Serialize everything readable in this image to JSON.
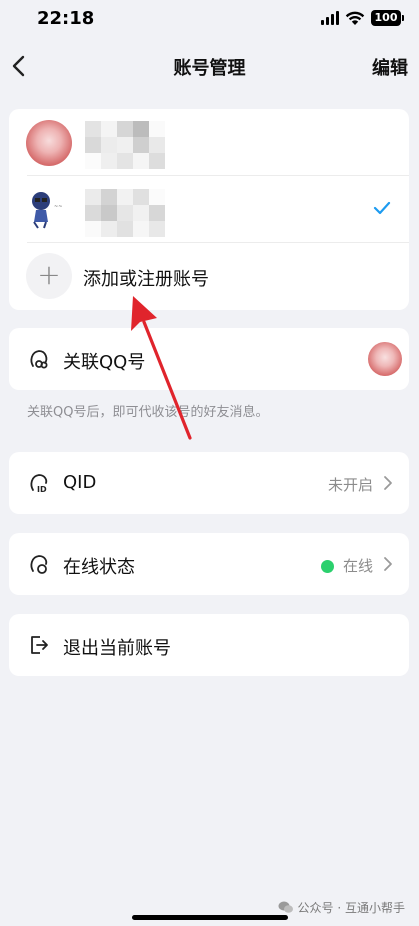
{
  "status_bar": {
    "time": "22:18",
    "battery": "100"
  },
  "nav": {
    "title": "账号管理",
    "edit": "编辑"
  },
  "accounts": {
    "add_label": "添加或注册账号"
  },
  "link_qq": {
    "label": "关联QQ号",
    "hint": "关联QQ号后，即可代收该号的好友消息。"
  },
  "qid": {
    "label": "QID",
    "value": "未开启"
  },
  "online_status": {
    "label": "在线状态",
    "value": "在线"
  },
  "logout": {
    "label": "退出当前账号"
  },
  "watermark": {
    "text": "公众号 · 互通小帮手"
  },
  "colors": {
    "accent": "#1d9bf0",
    "online": "#2bd06d",
    "arrow": "#e0242c",
    "background": "#f1f2f6"
  }
}
